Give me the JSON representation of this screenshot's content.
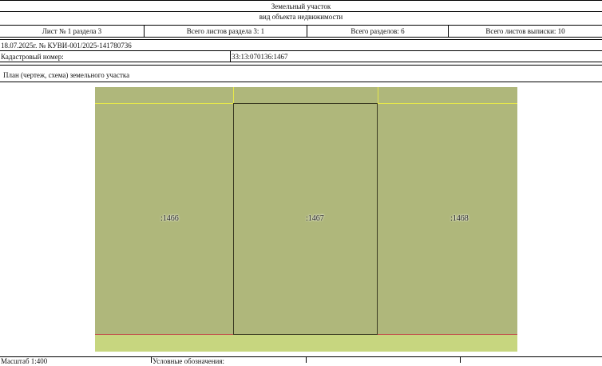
{
  "header": {
    "line1": "Земельный участок",
    "line2": "вид объекта недвижимости"
  },
  "sheet_info": {
    "sheet": "Лист № 1 раздела 3",
    "total_sheets_section": "Всего листов раздела 3: 1",
    "total_sections": "Всего разделов: 6",
    "total_sheets": "Всего листов выписки: 10"
  },
  "document_ref": "18.07.2025г. № КУВИ-001/2025-141780736",
  "cadastral": {
    "label": "Кадастровый номер:",
    "value": "33:13:070136:1467"
  },
  "plan_title": "План (чертеж, схема) земельного участка",
  "plan": {
    "parcels": [
      {
        "id": "left",
        "label": ":1466"
      },
      {
        "id": "center",
        "label": ":1467"
      },
      {
        "id": "right",
        "label": ":1468"
      }
    ],
    "colors": {
      "fill": "#afb77b",
      "strip": "#c7d67f",
      "boundary_red": "#c0504d",
      "boundary_yellow": "#e6e84a",
      "outline": "#3a3a22"
    }
  },
  "footer": {
    "scale": "Масштаб 1:400",
    "legend_label": "Условные обозначения:"
  }
}
